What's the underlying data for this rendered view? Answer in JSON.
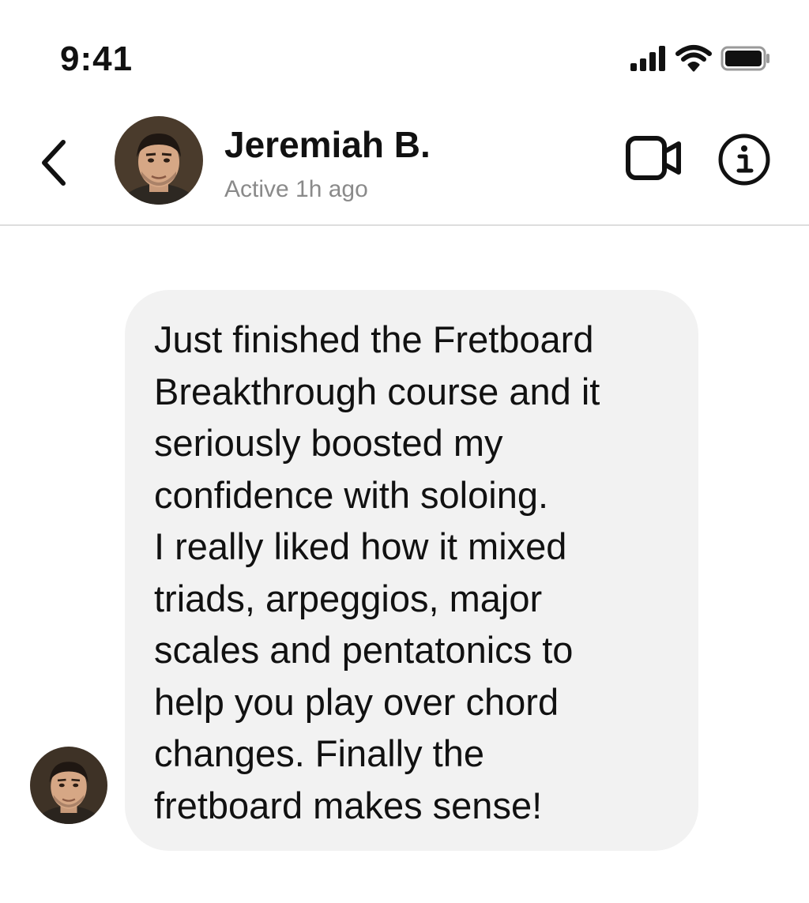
{
  "status_bar": {
    "time": "9:41",
    "icons": [
      "cellular-signal-icon",
      "wifi-icon",
      "battery-icon"
    ]
  },
  "header": {
    "back_icon": "chevron-left-icon",
    "contact": {
      "name": "Jeremiah B.",
      "status": "Active 1h ago",
      "avatar": "avatar"
    },
    "actions": [
      {
        "icon": "video-camera-icon"
      },
      {
        "icon": "info-icon"
      }
    ]
  },
  "conversation": {
    "messages": [
      {
        "sender": "Jeremiah B.",
        "text": "Just finished the Fretboard\nBreakthrough course and it\nseriously boosted my\nconfidence with soloing.\nI really liked how it mixed\ntriads, arpeggios, major\nscales and pentatonics to\nhelp you play over chord\nchanges. Finally the\nfretboard makes sense!"
      }
    ]
  },
  "colors": {
    "bubble_bg": "#f2f2f2",
    "text": "#111111",
    "secondary_text": "#8a8a8a",
    "divider": "#dddddd"
  }
}
